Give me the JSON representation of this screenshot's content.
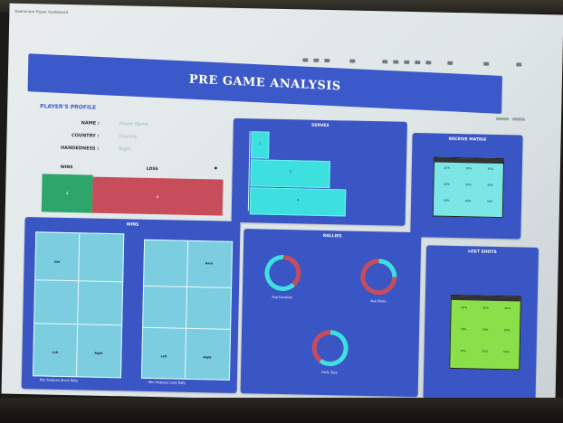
{
  "window": {
    "title": "Badminton Player Dashboard"
  },
  "banner": {
    "title": "PRE GAME ANALYSIS"
  },
  "profile": {
    "title": "PLAYER'S PROFILE",
    "rows": [
      {
        "label": "NAME :",
        "value": "Player Name"
      },
      {
        "label": "COUNTRY :",
        "value": "Country"
      },
      {
        "label": "HANDEDNESS :",
        "value": "Right"
      }
    ],
    "win_label": "WINS",
    "loss_label": "LOSS",
    "win_value": "4",
    "loss_value": "6"
  },
  "serves": {
    "title": "SERVES",
    "bars": [
      {
        "value": "1",
        "pct": "10%"
      },
      {
        "value": "3",
        "pct": "40%"
      },
      {
        "value": "4",
        "pct": "50%"
      }
    ]
  },
  "receive": {
    "title": "RECEIVE MATRIX",
    "cells": [
      "40%",
      "30%",
      "30%",
      "20%",
      "50%",
      "30%",
      "30%",
      "40%",
      "30%"
    ]
  },
  "wins": {
    "title": "WINS",
    "court1_caption": "Win Analysis Short Rally",
    "court2_caption": "Win Analysis Long Rally",
    "labels": [
      "Net",
      "Back",
      "Mid",
      "Left",
      "Right"
    ]
  },
  "rallies": {
    "title": "RALLIES",
    "ring1": "Avg Duration",
    "ring2": "Avg Shots",
    "ring3": "Rally Type"
  },
  "lost": {
    "title": "LOST SHOTS",
    "cells": [
      "20%",
      "30%",
      "40%",
      "30%",
      "40%",
      "20%",
      "10%",
      "30%",
      "60%"
    ]
  },
  "colors": {
    "banner": "#3c59c9",
    "panel": "#3a55c4",
    "win": "#2ea56b",
    "loss": "#c84d5b",
    "cyan": "#3ee0df",
    "green": "#8be04a"
  }
}
